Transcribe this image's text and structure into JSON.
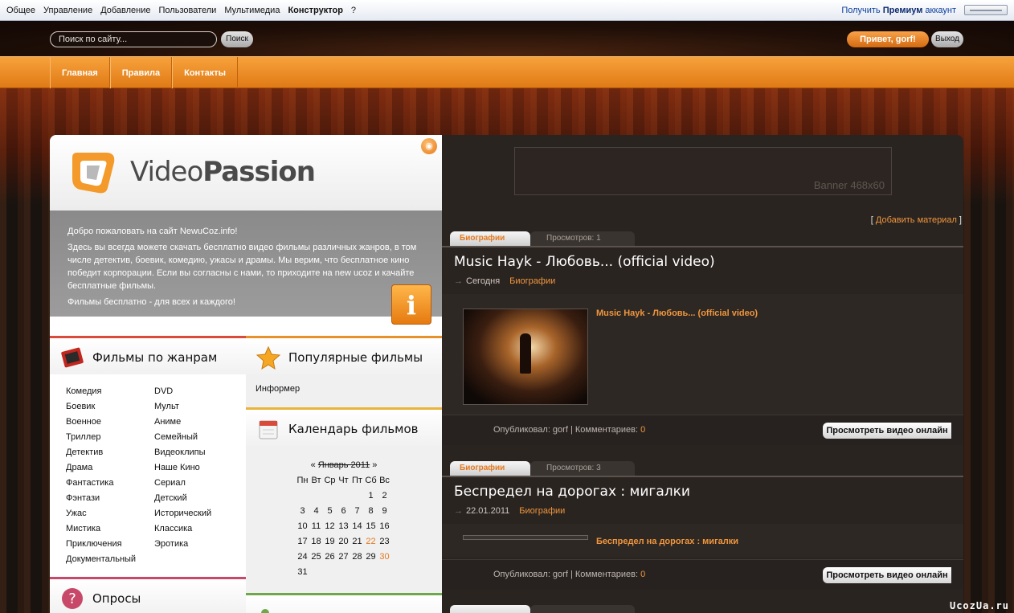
{
  "adminbar": {
    "menu": [
      "Общее",
      "Управление",
      "Добавление",
      "Пользователи",
      "Мультимедиа",
      "Конструктор",
      "?"
    ],
    "premium_prefix": "Получить",
    "premium_bold": "Премиум",
    "premium_suffix": "аккаунт"
  },
  "header": {
    "search_placeholder": "Поиск по сайту...",
    "search_button": "Поиск",
    "greeting": "Привет, gorf!",
    "logout": "Выход"
  },
  "nav": [
    "Главная",
    "Правила",
    "Контакты"
  ],
  "logo": {
    "part1": "Video",
    "part2": "Passion"
  },
  "welcome": {
    "lines": [
      "Добро пожаловать на сайт NewuCoz.info!",
      "Здесь вы всегда можете скачать бесплатно видео фильмы различных жанров, в том числе детектив, боевик, комедию, ужасы и драмы. Мы верим, что бесплатное кино победит корпорации. Если вы согласны с нами, то приходите на new ucoz и качайте бесплатные фильмы.",
      "Фильмы бесплатно - для всех и каждого!"
    ],
    "info_icon": "i"
  },
  "blocks": {
    "genres_title": "Фильмы по жанрам",
    "popular_title": "Популярные фильмы",
    "informer": "Информер",
    "calendar_title": "Календарь фильмов",
    "polls_title": "Опросы"
  },
  "genres": {
    "col1": [
      "Комедия",
      "Боевик",
      "Военное",
      "Триллер",
      "Детектив",
      "Драма",
      "Фантастика",
      "Фэнтази",
      "Ужас",
      "Мистика",
      "Приключения",
      "Документальный"
    ],
    "col2": [
      "DVD",
      "Мульт",
      "Аниме",
      "Семейный",
      "Видеоклипы",
      "Наше Кино",
      "Сериал",
      "Детский",
      "Исторический",
      "Классика",
      "Эротика"
    ]
  },
  "calendar": {
    "prev": "«",
    "month": "Январь 2011",
    "next": "»",
    "weekdays": [
      "Пн",
      "Вт",
      "Ср",
      "Чт",
      "Пт",
      "Сб",
      "Вс"
    ],
    "weeks": [
      [
        "",
        "",
        "",
        "",
        "",
        "1",
        "2"
      ],
      [
        "3",
        "4",
        "5",
        "6",
        "7",
        "8",
        "9"
      ],
      [
        "10",
        "11",
        "12",
        "13",
        "14",
        "15",
        "16"
      ],
      [
        "17",
        "18",
        "19",
        "20",
        "21",
        "22",
        "23"
      ],
      [
        "24",
        "25",
        "26",
        "27",
        "28",
        "29",
        "30"
      ],
      [
        "31",
        "",
        "",
        "",
        "",
        "",
        ""
      ]
    ],
    "highlighted": [
      "22",
      "30"
    ]
  },
  "banner": "Banner 468x60",
  "add_material": "Добавить материал",
  "entries": [
    {
      "category": "Биографии",
      "views": "Просмотров: 1",
      "title": "Music Hayk - Любовь... (official video)",
      "date": "Сегодня",
      "meta_category": "Биографии",
      "link": "Music Hayk - Любовь... (official video)",
      "author_label": "Опубликовал: gorf | Комментариев:",
      "comments": "0",
      "watch": "Просмотреть видео онлайн"
    },
    {
      "category": "Биографии",
      "views": "Просмотров: 3",
      "title": "Беспредел на дорогах : мигалки",
      "date": "22.01.2011",
      "meta_category": "Биографии",
      "link": "Беспредел на дорогах : мигалки",
      "author_label": "Опубликовал: gorf | Комментариев:",
      "comments": "0",
      "watch": "Просмотреть видео онлайн"
    }
  ],
  "watermark": "UcozUa.ru",
  "colors": {
    "accent": "#e57a20",
    "nav": "#f0902a",
    "dark": "#2a2421"
  }
}
